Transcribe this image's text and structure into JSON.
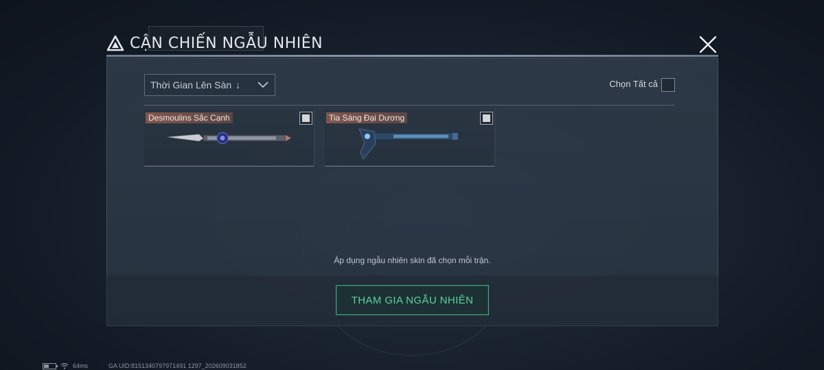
{
  "dialog": {
    "title": "CẬN CHIẾN NGẪU NHIÊN",
    "close_icon": "close-icon",
    "title_icon": "triangle-logo-icon"
  },
  "sort": {
    "label": "Thời Gian Lên Sàn",
    "arrow": "↓",
    "icon": "chevron-down-icon"
  },
  "select_all": {
    "label": "Chọn Tất cả",
    "checked": false
  },
  "items": [
    {
      "name": "Desmoulins Sắc Cạnh",
      "checked": true,
      "icon": "knife-icon"
    },
    {
      "name": "Tia Sáng Đại Dương",
      "checked": true,
      "icon": "axe-icon"
    }
  ],
  "hint": "Áp dụng ngẫu nhiên skin đã chọn mỗi trận.",
  "join_button": {
    "label": "THAM GIA NGẪU NHIÊN"
  },
  "colors": {
    "accent_green": "#5cd39a",
    "item_tag": "#965f50",
    "panel": "#303c4a"
  },
  "status_bar": {
    "ping": "64ms",
    "uid": "GA UID:8151340797971491 1297_202609031852"
  }
}
